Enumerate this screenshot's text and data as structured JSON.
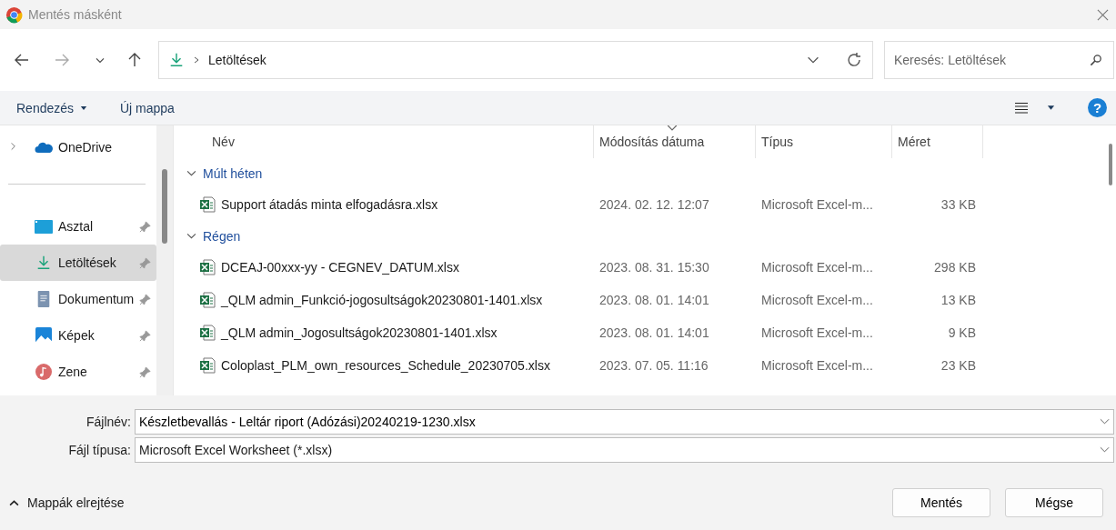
{
  "window": {
    "title": "Mentés másként"
  },
  "nav": {
    "path": "Letöltések",
    "search_placeholder": "Keresés: Letöltések"
  },
  "toolbar": {
    "organize": "Rendezés",
    "new_folder": "Új mappa",
    "help": "?"
  },
  "sidebar": {
    "items": [
      {
        "label": "OneDrive",
        "kind": "cloud",
        "pinned": false,
        "expandable": true,
        "selected": false
      },
      {
        "label": "Asztal",
        "kind": "desktop",
        "pinned": true,
        "expandable": false,
        "selected": false
      },
      {
        "label": "Letöltések",
        "kind": "download",
        "pinned": true,
        "expandable": false,
        "selected": true
      },
      {
        "label": "Dokumentum",
        "kind": "documents",
        "pinned": true,
        "expandable": false,
        "selected": false
      },
      {
        "label": "Képek",
        "kind": "pictures",
        "pinned": true,
        "expandable": false,
        "selected": false
      },
      {
        "label": "Zene",
        "kind": "music",
        "pinned": true,
        "expandable": false,
        "selected": false
      }
    ]
  },
  "table": {
    "columns": [
      "Név",
      "Módosítás dátuma",
      "Típus",
      "Méret"
    ],
    "groups": [
      {
        "label": "Múlt héten",
        "expanded": true,
        "rows": [
          {
            "name": "Support átadás minta elfogadásra.xlsx",
            "date": "2024. 02. 12. 12:07",
            "type": "Microsoft Excel-m...",
            "size": "33 KB"
          }
        ]
      },
      {
        "label": "Régen",
        "expanded": true,
        "rows": [
          {
            "name": "DCEAJ-00xxx-yy - CEGNEV_DATUM.xlsx",
            "date": "2023. 08. 31. 15:30",
            "type": "Microsoft Excel-m...",
            "size": "298 KB"
          },
          {
            "name": "_QLM admin_Funkció-jogosultságok20230801-1401.xlsx",
            "date": "2023. 08. 01. 14:01",
            "type": "Microsoft Excel-m...",
            "size": "13 KB"
          },
          {
            "name": "_QLM admin_Jogosultságok20230801-1401.xlsx",
            "date": "2023. 08. 01. 14:01",
            "type": "Microsoft Excel-m...",
            "size": "9 KB"
          },
          {
            "name": "Coloplast_PLM_own_resources_Schedule_20230705.xlsx",
            "date": "2023. 07. 05. 11:16",
            "type": "Microsoft Excel-m...",
            "size": "23 KB"
          }
        ]
      }
    ]
  },
  "form": {
    "filename_label": "Fájlnév:",
    "filename": "Készletbevallás - Leltár riport (Adózási)20240219-1230.xlsx",
    "filetype_label": "Fájl típusa:",
    "filetype": "Microsoft Excel Worksheet (*.xlsx)"
  },
  "footer": {
    "hide_folders": "Mappák elrejtése",
    "save": "Mentés",
    "cancel": "Mégse"
  }
}
